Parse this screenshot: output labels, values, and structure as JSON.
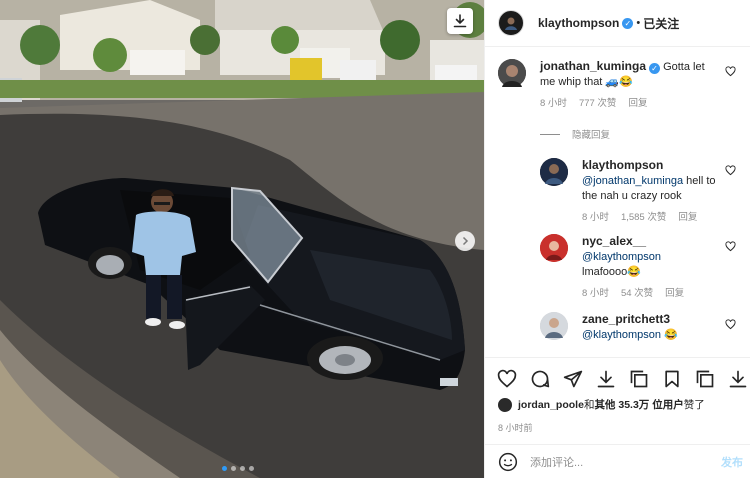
{
  "photo": {
    "slides": 4,
    "current": 1
  },
  "header": {
    "username": "klaythompson",
    "dot": "•",
    "follow_label": "已关注"
  },
  "comments": [
    {
      "username": "jonathan_kuminga",
      "verified": true,
      "text": "Gotta let me whip that 🚙😂",
      "time": "8 小时",
      "likes": "777 次赞",
      "reply": "回复"
    },
    {
      "username": "klaythompson",
      "verified": false,
      "mention": "@jonathan_kuminga",
      "text": " hell to the nah u crazy rook",
      "time": "8 小时",
      "likes": "1,585 次赞",
      "reply": "回复"
    },
    {
      "username": "nyc_alex__",
      "verified": false,
      "mention": "@klaythompson",
      "text": "lmafoooo😂",
      "time": "8 小时",
      "likes": "54 次赞",
      "reply": "回复"
    },
    {
      "username": "zane_pritchett3",
      "verified": false,
      "mention": "@klaythompson",
      "text": " 😂"
    }
  ],
  "hidden_replies_label": "隐藏回复",
  "likes": {
    "user": "jordan_poole",
    "and": " 和 ",
    "others": "其他 35.3万 位用户",
    "suffix": " 赞了"
  },
  "post_time": "8 小时前",
  "comment_box": {
    "placeholder": "添加评论...",
    "post_label": "发布"
  },
  "icons": [
    "download-icon",
    "chevron-right-icon",
    "more-icon",
    "heart-icon",
    "comment-icon",
    "share-icon",
    "save-icon",
    "emoji-icon"
  ],
  "colors": {
    "accent": "#3897f0",
    "link": "#00376b",
    "muted": "#8e8e8e"
  }
}
